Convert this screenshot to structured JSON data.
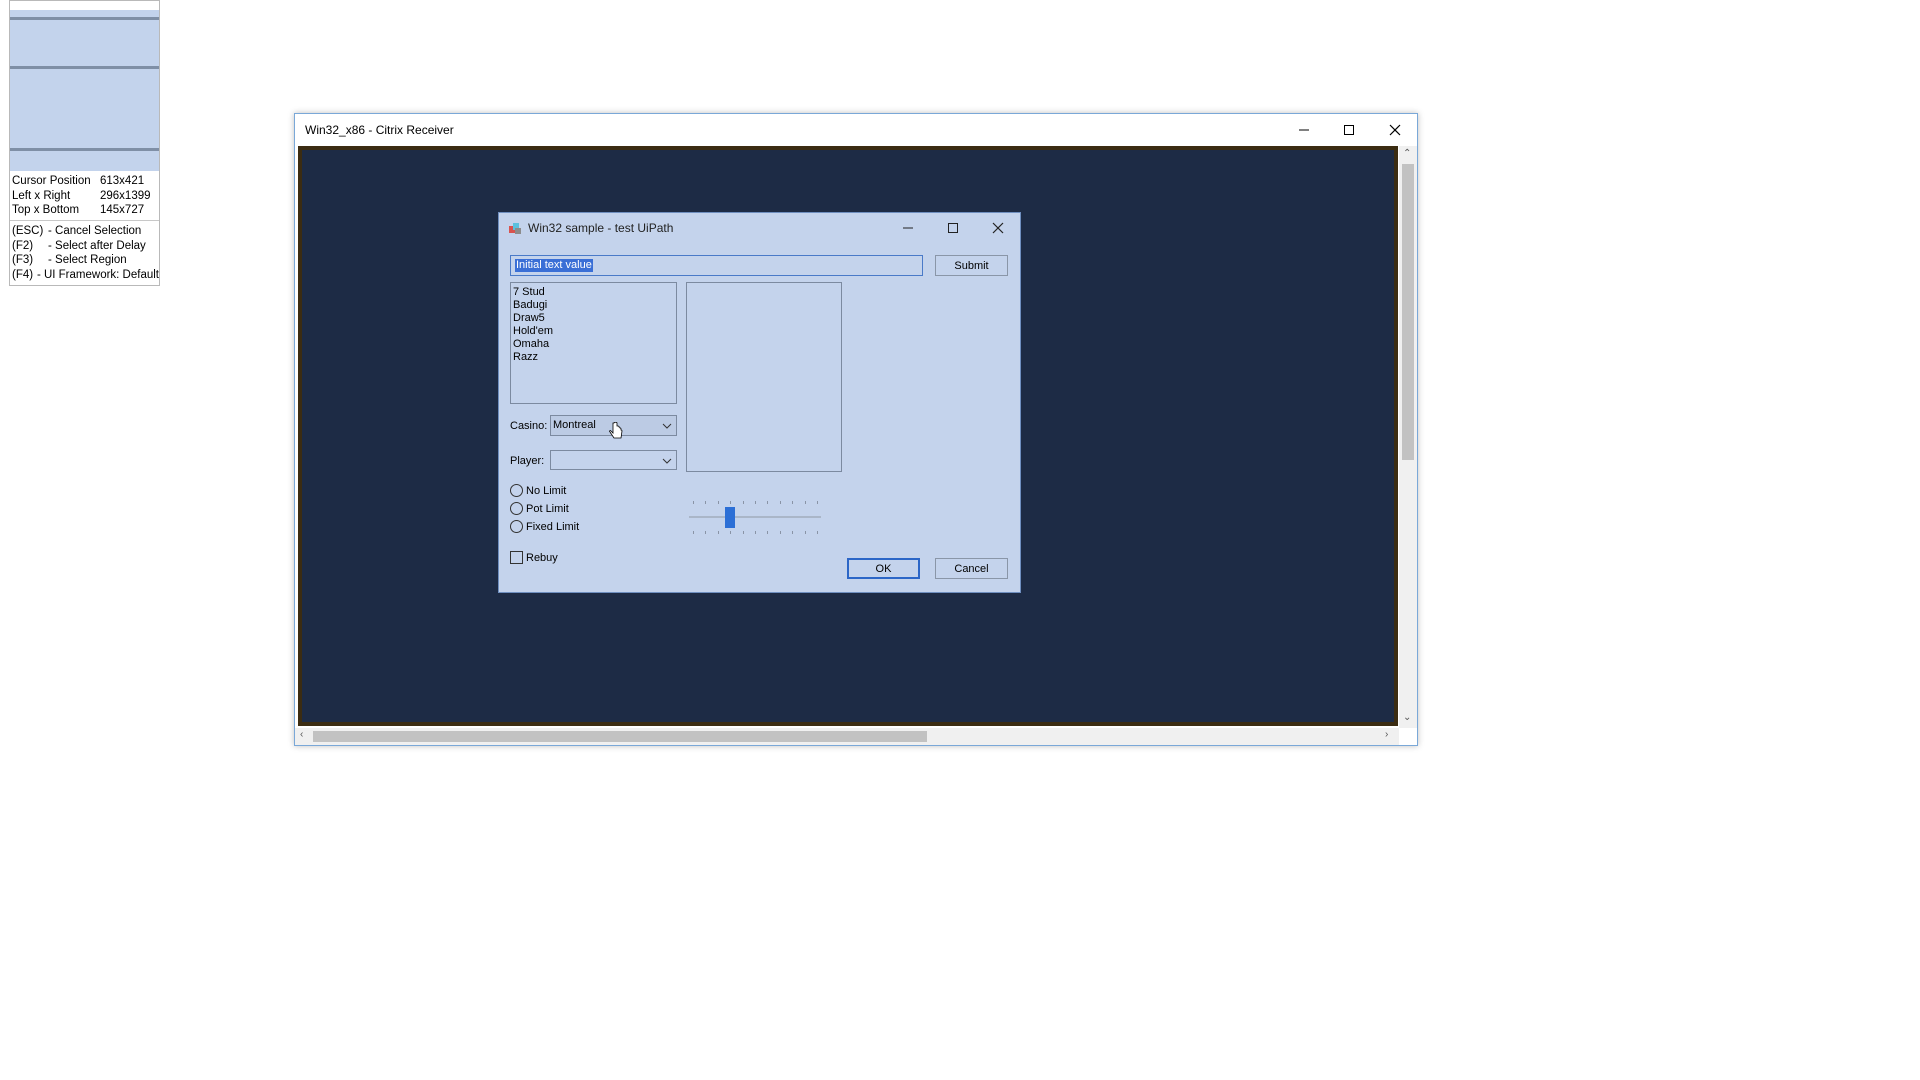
{
  "helper": {
    "rows": [
      {
        "label": "Cursor Position",
        "value": "613x421"
      },
      {
        "label": "Left x Right",
        "value": "296x1399"
      },
      {
        "label": "Top x Bottom",
        "value": "145x727"
      }
    ],
    "keys": [
      {
        "key": "(ESC)",
        "desc": "- Cancel Selection"
      },
      {
        "key": "(F2)",
        "desc": "- Select after Delay"
      },
      {
        "key": "(F3)",
        "desc": "- Select Region"
      },
      {
        "key": "(F4)",
        "desc": "- UI Framework: Default"
      }
    ]
  },
  "citrix": {
    "title": "Win32_x86 - Citrix Receiver"
  },
  "dialog": {
    "title": "Win32 sample - test UiPath",
    "text_value": "Initial text value",
    "submit_label": "Submit",
    "list_items": [
      "7 Stud",
      "Badugi",
      "Draw5",
      "Hold'em",
      "Omaha",
      "Razz"
    ],
    "casino_label": "Casino:",
    "casino_value": "Montreal",
    "player_label": "Player:",
    "player_value": "",
    "radios": [
      "No Limit",
      "Pot Limit",
      "Fixed Limit"
    ],
    "rebuy_label": "Rebuy",
    "ok_label": "OK",
    "cancel_label": "Cancel",
    "slider_level": 0.3
  },
  "colors": {
    "dialog_bg": "#c4d3ec",
    "session_bg": "#1d2b45",
    "selection": "#3a6fd6"
  }
}
